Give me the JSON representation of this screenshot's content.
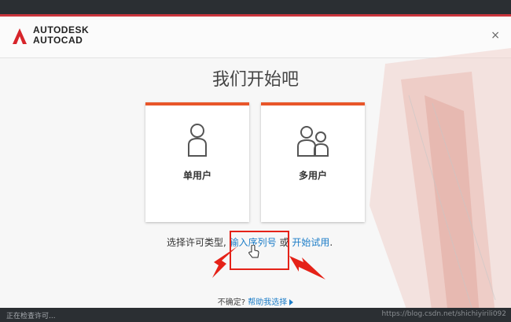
{
  "app": {
    "brand_line1": "AUTODESK",
    "brand_line2": "AUTOCAD"
  },
  "header": {
    "close_glyph": "×"
  },
  "main": {
    "title": "我们开始吧",
    "cards": [
      {
        "label": "单用户",
        "icon": "single-user-icon"
      },
      {
        "label": "多用户",
        "icon": "multi-user-icon"
      }
    ],
    "license": {
      "prompt": "选择许可类型,",
      "serial_link": "输入序列号",
      "or": "或",
      "trial_link": "开始试用",
      "end": "."
    }
  },
  "footer": {
    "prefix": "不确定?",
    "help_link": "帮助我选择"
  },
  "statusbar": {
    "text": "正在检查许可...",
    "watermark": "https://blog.csdn.net/shichiyirili092"
  },
  "colors": {
    "accent": "#e8562a",
    "link": "#1e7ec8",
    "annotation": "#e52218"
  }
}
